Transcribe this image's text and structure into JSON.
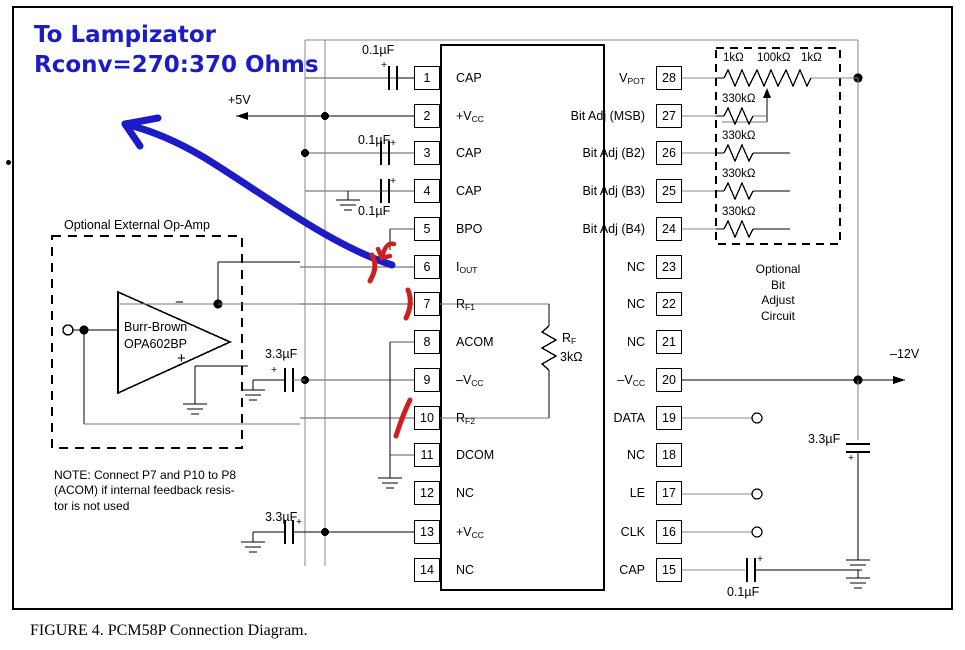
{
  "figure": {
    "caption": "FIGURE 4. PCM58P Connection Diagram.",
    "chip_name": "PCM58P"
  },
  "annotations": {
    "blue_line1": "To Lampizator",
    "blue_line2": "Rconv=270:370 Ohms",
    "blue_color": "#1b1bc8",
    "red_color": "#cc2020",
    "red_marks": [
      "cut-mark-pin6",
      "cut-mark-pin7",
      "cut-mark-pin10",
      "arrow-to-pin6"
    ]
  },
  "rails": {
    "pos_supply": "+5V",
    "neg_supply": "–12V"
  },
  "ic": {
    "left_pins": [
      {
        "num": "1",
        "name": "CAP"
      },
      {
        "num": "2",
        "name": "+V",
        "sub": "CC"
      },
      {
        "num": "3",
        "name": "CAP"
      },
      {
        "num": "4",
        "name": "CAP"
      },
      {
        "num": "5",
        "name": "BPO"
      },
      {
        "num": "6",
        "name": "I",
        "sub": "OUT"
      },
      {
        "num": "7",
        "name": "R",
        "sub": "F1"
      },
      {
        "num": "8",
        "name": "ACOM"
      },
      {
        "num": "9",
        "name": "–V",
        "sub": "CC"
      },
      {
        "num": "10",
        "name": "R",
        "sub": "F2"
      },
      {
        "num": "11",
        "name": "DCOM"
      },
      {
        "num": "12",
        "name": "NC"
      },
      {
        "num": "13",
        "name": "+V",
        "sub": "CC"
      },
      {
        "num": "14",
        "name": "NC"
      }
    ],
    "right_pins": [
      {
        "num": "28",
        "name": "V",
        "sub": "POT"
      },
      {
        "num": "27",
        "name": "Bit Adj (MSB)"
      },
      {
        "num": "26",
        "name": "Bit Adj (B2)"
      },
      {
        "num": "25",
        "name": "Bit Adj (B3)"
      },
      {
        "num": "24",
        "name": "Bit Adj (B4)"
      },
      {
        "num": "23",
        "name": "NC"
      },
      {
        "num": "22",
        "name": "NC"
      },
      {
        "num": "21",
        "name": "NC"
      },
      {
        "num": "20",
        "name": "–V",
        "sub": "CC"
      },
      {
        "num": "19",
        "name": "DATA"
      },
      {
        "num": "18",
        "name": "NC"
      },
      {
        "num": "17",
        "name": "LE"
      },
      {
        "num": "16",
        "name": "CLK"
      },
      {
        "num": "15",
        "name": "CAP"
      }
    ]
  },
  "components": {
    "cap_pin1": "0.1µF",
    "cap_pin3": "0.1µF",
    "cap_pin4": "0.1µF",
    "cap_pin9": "3.3µF",
    "cap_pin13": "3.3µF",
    "cap_pin15": "0.1µF",
    "cap_neg12": "3.3µF",
    "feedback_res_name": "R",
    "feedback_res_sub": "F",
    "feedback_res_value": "3kΩ",
    "polarity_plus": "+"
  },
  "opamp": {
    "box_title": "Optional External Op-Amp",
    "brand": "Burr-Brown",
    "part": "OPA602BP",
    "inv_input": "−",
    "noninv_input": "+",
    "note": "NOTE: Connect P7 and P10 to P8 (ACOM) if internal feedback resis-tor is not used",
    "note_lines": [
      "NOTE: Connect P7 and P10 to P8",
      "(ACOM) if internal feedback resis-",
      "tor is not used"
    ]
  },
  "bit_adjust": {
    "title_lines": [
      "Optional",
      "Bit",
      "Adjust",
      "Circuit"
    ],
    "top_resistors": [
      "1kΩ",
      "100kΩ",
      "1kΩ"
    ],
    "bit_resistors": [
      "330kΩ",
      "330kΩ",
      "330kΩ",
      "330kΩ"
    ]
  }
}
